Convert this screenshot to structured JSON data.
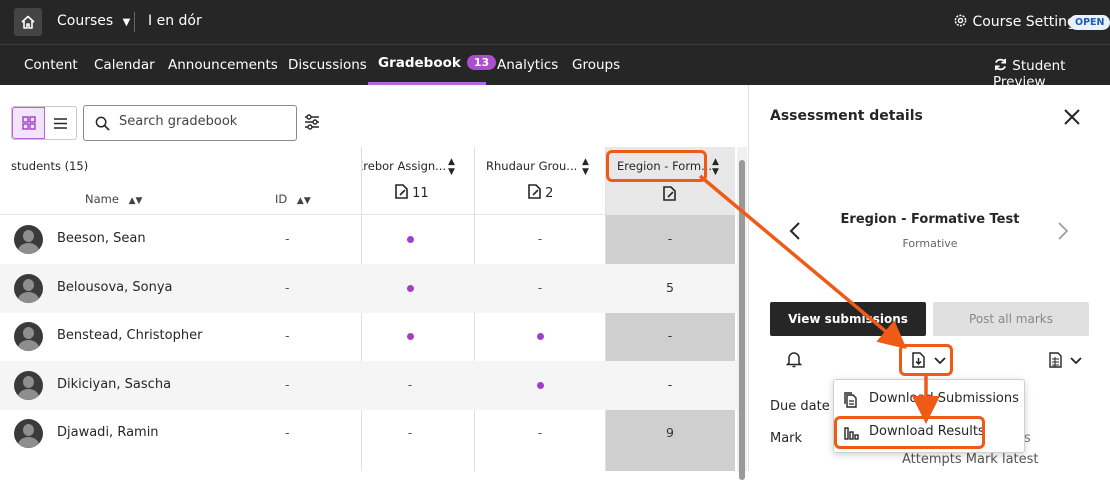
{
  "topbar": {
    "courses_label": "Courses",
    "course_name": "I en dór",
    "settings_label": "Course Settings",
    "status_badge": "OPEN"
  },
  "nav": {
    "tabs": [
      {
        "label": "Content"
      },
      {
        "label": "Calendar"
      },
      {
        "label": "Announcements"
      },
      {
        "label": "Discussions"
      },
      {
        "label": "Gradebook",
        "badge": "13"
      },
      {
        "label": "Analytics"
      },
      {
        "label": "Groups"
      }
    ],
    "student_preview": "Student Preview"
  },
  "gradebook": {
    "search_placeholder": "Search gradebook",
    "students_count": "students (15)",
    "col_name": "Name",
    "col_id": "ID",
    "columns": [
      {
        "title": "Erebor Assign...",
        "count": "11"
      },
      {
        "title": "Rhudaur Grou...",
        "count": "2"
      },
      {
        "title": "Eregion - Form...",
        "count": ""
      }
    ],
    "rows": [
      {
        "name": "Beeson, Sean",
        "id": "-",
        "c1": "dot",
        "c2": "-",
        "c3": "-"
      },
      {
        "name": "Belousova, Sonya",
        "id": "-",
        "c1": "dot",
        "c2": "-",
        "c3": "5"
      },
      {
        "name": "Benstead, Christopher",
        "id": "-",
        "c1": "dot",
        "c2": "dot",
        "c3": "-"
      },
      {
        "name": "Dikiciyan, Sascha",
        "id": "-",
        "c1": "-",
        "c2": "dot",
        "c3": "-"
      },
      {
        "name": "Djawadi, Ramin",
        "id": "-",
        "c1": "-",
        "c2": "-",
        "c3": "9"
      }
    ]
  },
  "panel": {
    "title": "Assessment details",
    "test_name": "Eregion - Formative Test",
    "test_type": "Formative",
    "view_submissions": "View submissions",
    "post_all_marks": "Post all marks",
    "due_date_label": "Due date",
    "mark_label": "Mark",
    "attempts_text": "Attempts Mark latest",
    "partial_text": "s"
  },
  "download_menu": {
    "items": [
      {
        "label": "Download Submissions"
      },
      {
        "label": "Download Results"
      }
    ]
  },
  "colors": {
    "accent": "#a94fcf",
    "highlight": "#ef5b17",
    "dark": "#262626"
  }
}
